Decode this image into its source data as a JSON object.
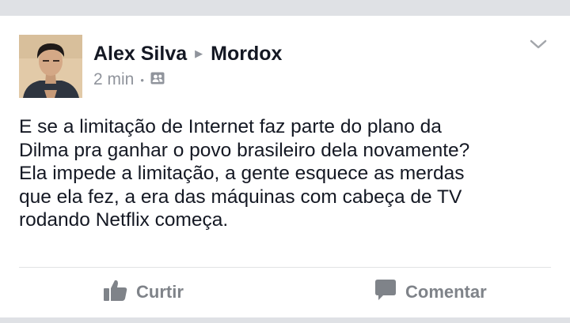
{
  "post": {
    "author": "Alex Silva",
    "target": "Mordox",
    "time": "2 min",
    "dot": "•",
    "privacy_icon": "friends-icon",
    "text_lines": [
      "E se a limitação de Internet faz parte do plano da",
      "Dilma pra ganhar o povo brasileiro dela novamente?",
      "Ela impede a limitação, a gente esquece as merdas",
      "que ela fez, a era das máquinas com cabeça de TV",
      "rodando Netflix começa."
    ]
  },
  "actions": {
    "like_label": "Curtir",
    "comment_label": "Comentar"
  },
  "colors": {
    "text": "#141823",
    "muted": "#90949c",
    "action": "#7f8389",
    "background": "#dfe1e5"
  }
}
